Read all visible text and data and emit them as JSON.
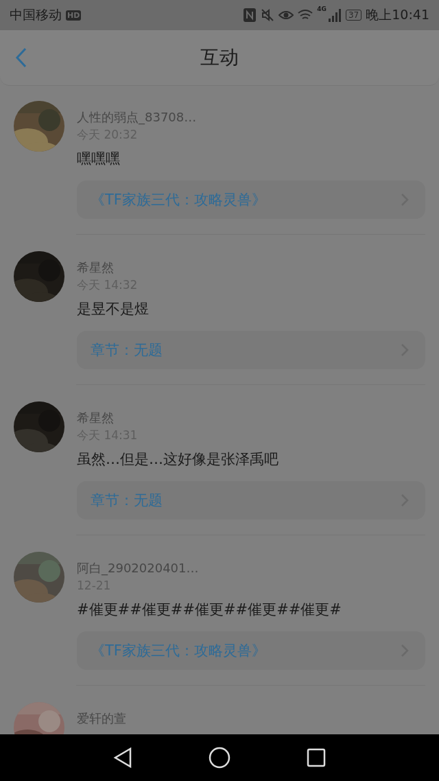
{
  "status_bar": {
    "carrier": "中国移动",
    "hd_badge": "HD",
    "network": "4G",
    "battery": "37",
    "time": "晚上10:41"
  },
  "header": {
    "title": "互动"
  },
  "comments": [
    {
      "user": "人性的弱点_83708…",
      "time": "今天 20:32",
      "text": "嘿嘿嘿",
      "link": "《TF家族三代：攻略灵兽》"
    },
    {
      "user": "希星然",
      "time": "今天 14:32",
      "text": "是昱不是煜",
      "link": "章节：无题"
    },
    {
      "user": "希星然",
      "time": "今天 14:31",
      "text": "虽然…但是…这好像是张泽禹吧",
      "link": "章节：无题"
    },
    {
      "user": "阿白_2902020401…",
      "time": "12-21",
      "text": "#催更##催更##催更##催更##催更#",
      "link": "《TF家族三代：攻略灵兽》"
    },
    {
      "user": "爱轩的萱"
    }
  ]
}
